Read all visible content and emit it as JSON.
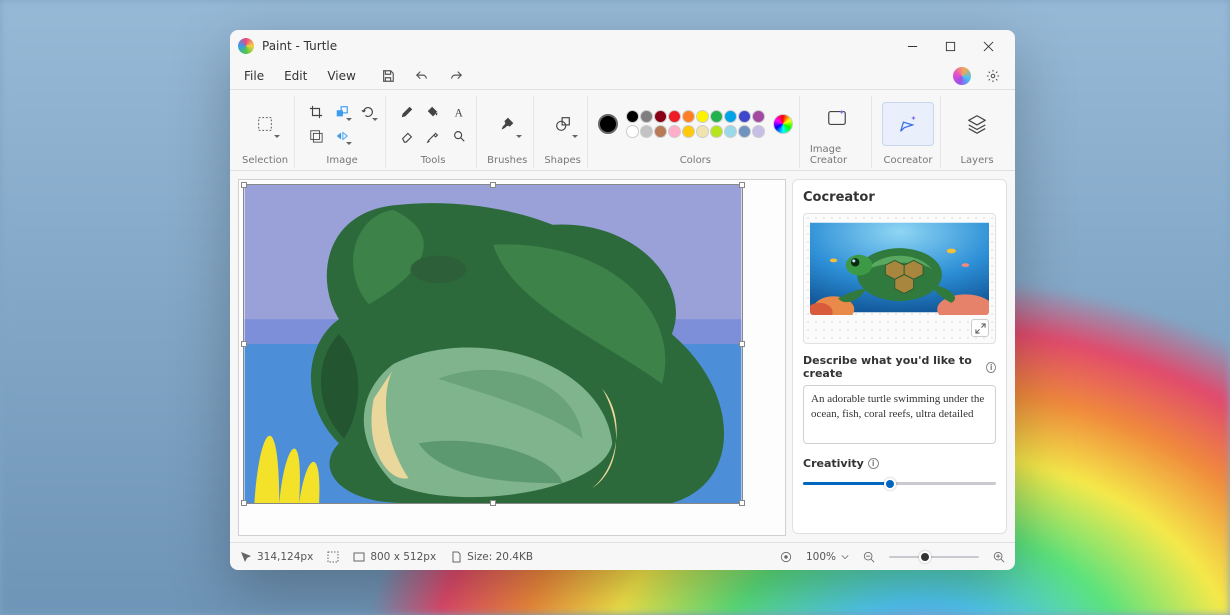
{
  "titlebar": {
    "title": "Paint - Turtle"
  },
  "menubar": {
    "file": "File",
    "edit": "Edit",
    "view": "View"
  },
  "ribbon": {
    "selection_label": "Selection",
    "image_label": "Image",
    "tools_label": "Tools",
    "brushes_label": "Brushes",
    "shapes_label": "Shapes",
    "colors_label": "Colors",
    "image_creator_label": "Image Creator",
    "cocreator_label": "Cocreator",
    "layers_label": "Layers"
  },
  "palette": {
    "current": "#000000",
    "row1": [
      "#000000",
      "#7f7f7f",
      "#880015",
      "#ed1c24",
      "#ff7f27",
      "#fff200",
      "#22b14c",
      "#00a2e8",
      "#3f48cc",
      "#a349a4"
    ],
    "row2": [
      "#ffffff",
      "#c3c3c3",
      "#b97a57",
      "#ffaec9",
      "#ffc90e",
      "#efe4b0",
      "#b5e61d",
      "#99d9ea",
      "#7092be",
      "#c8bfe7"
    ]
  },
  "cocreator": {
    "title": "Cocreator",
    "describe_label": "Describe what you'd like to create",
    "prompt": "An adorable turtle swimming under the ocean, fish, coral reefs, ultra detailed",
    "creativity_label": "Creativity",
    "creativity_pct": 45
  },
  "status": {
    "cursor": "314,124px",
    "canvas": "800  x  512px",
    "size": "Size: 20.4KB",
    "zoom": "100%",
    "zoom_pct": 40
  }
}
